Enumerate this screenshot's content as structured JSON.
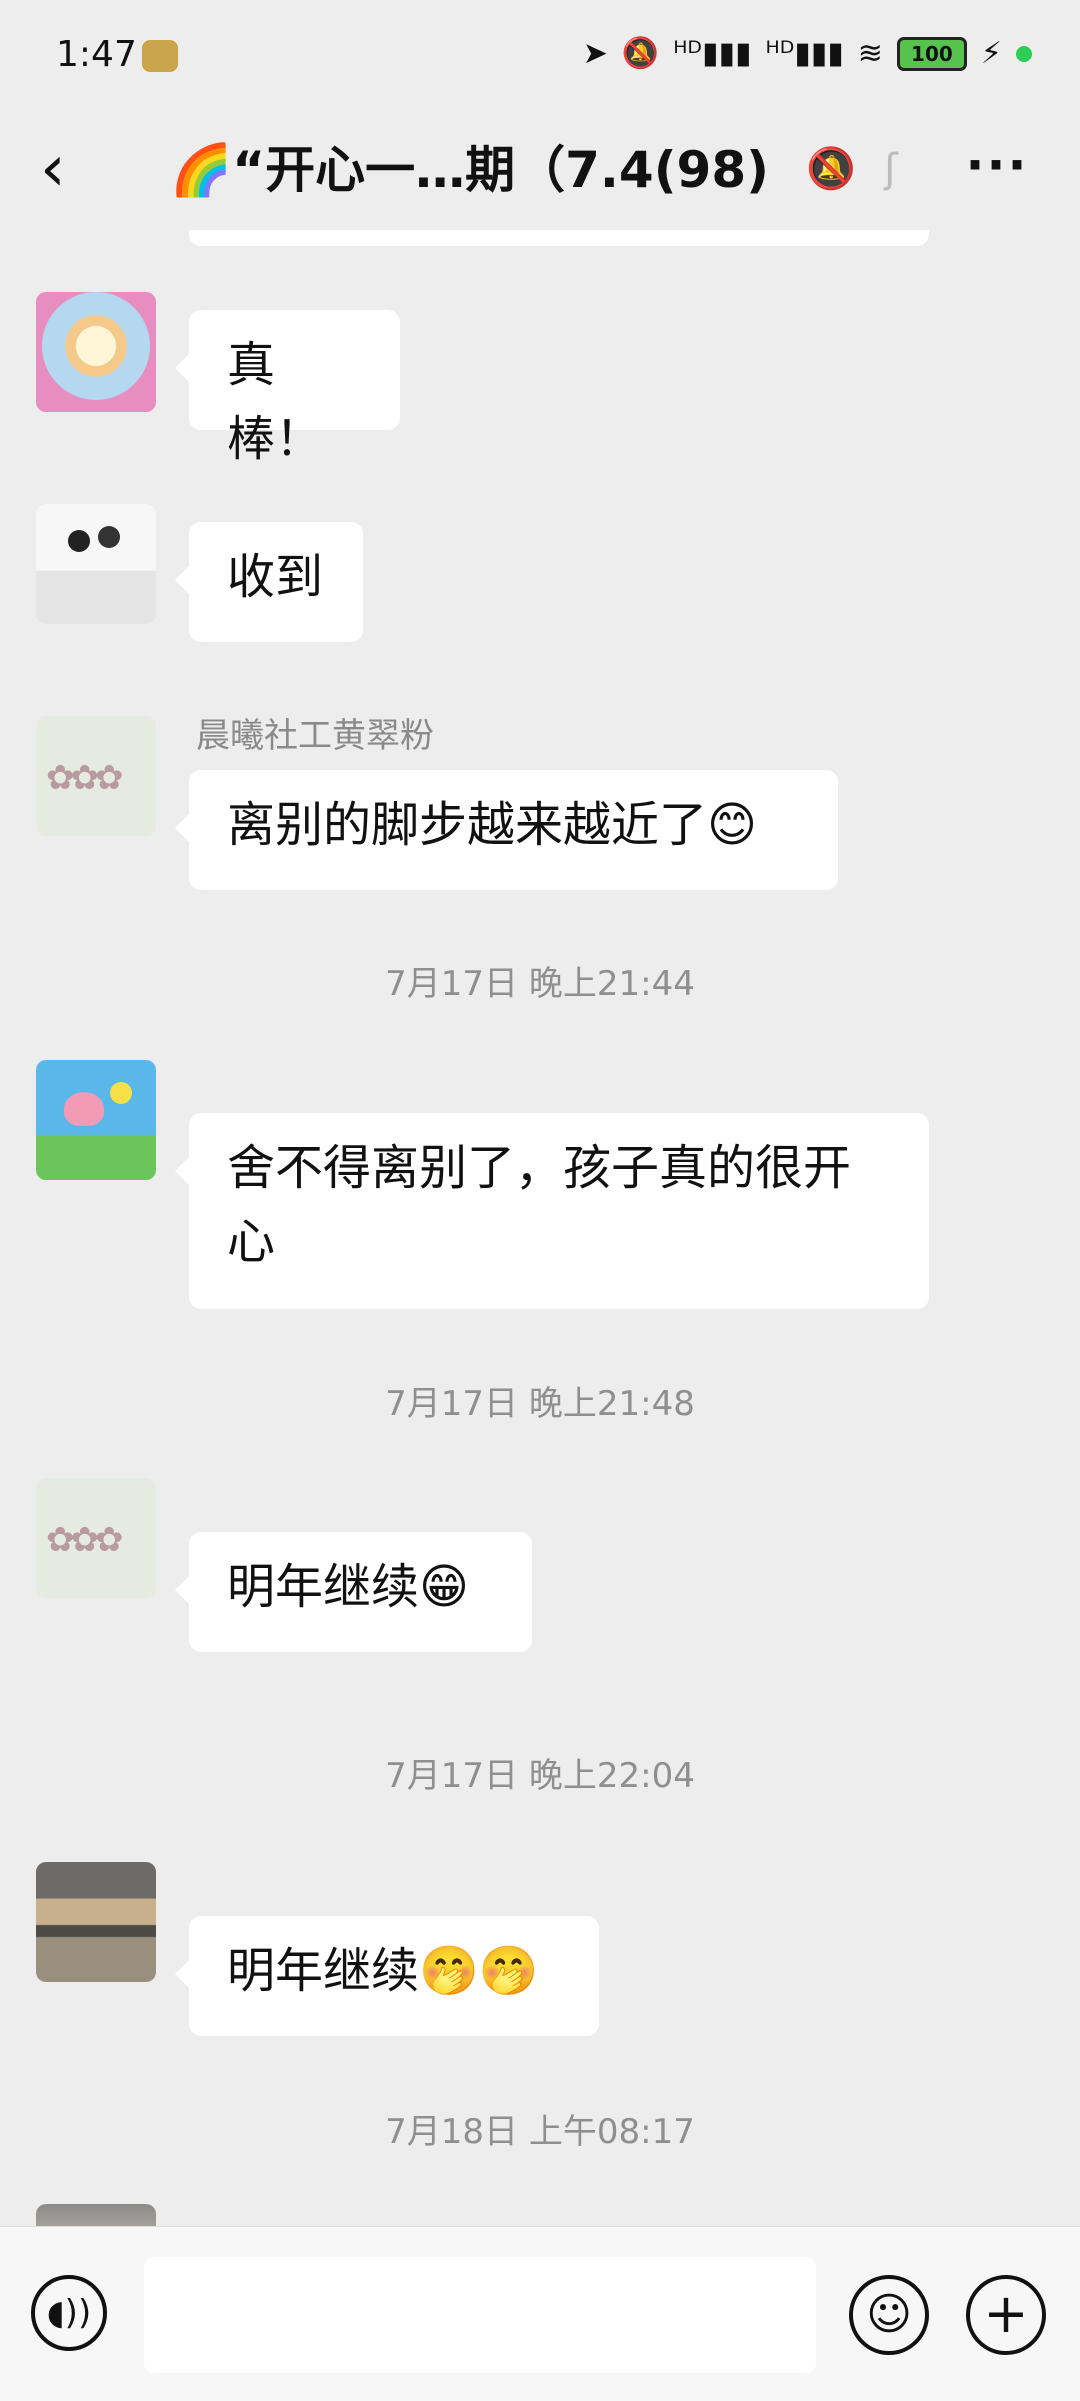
{
  "status_bar": {
    "time": "1:47",
    "signal1": "ᴴᴰ▮▮▮",
    "signal2": "ᴴᴰ▮▮▮",
    "wifi": "≋",
    "battery": "100",
    "charging": "⚡"
  },
  "nav": {
    "back_icon": "‹",
    "title": "🌈“开心一…期（7.4(98)",
    "mute_icon": "🔕",
    "ear_icon": "ʃ",
    "more_icon": "···"
  },
  "messages": [
    {
      "text": "真棒！"
    },
    {
      "text": "收到"
    },
    {
      "sender": "晨曦社工黄翠粉",
      "text": "离别的脚步越来越近了😊"
    },
    {
      "timestamp": "7月17日 晚上21:44"
    },
    {
      "text_line1": "舍不得离别了，孩子真的很开",
      "text_line2": "心"
    },
    {
      "timestamp": "7月17日 晚上21:48"
    },
    {
      "text": "明年继续😁"
    },
    {
      "timestamp": "7月17日 晚上22:04"
    },
    {
      "text": "明年继续🤭🤭"
    },
    {
      "timestamp": "7月18日 上午08:17"
    }
  ],
  "input_bar": {
    "voice_icon": "◖))",
    "emoji_icon": "☺",
    "plus_icon": "+"
  },
  "colors": {
    "background": "#ededed",
    "bubble": "#ffffff",
    "timestamp": "#8f8f8f"
  }
}
